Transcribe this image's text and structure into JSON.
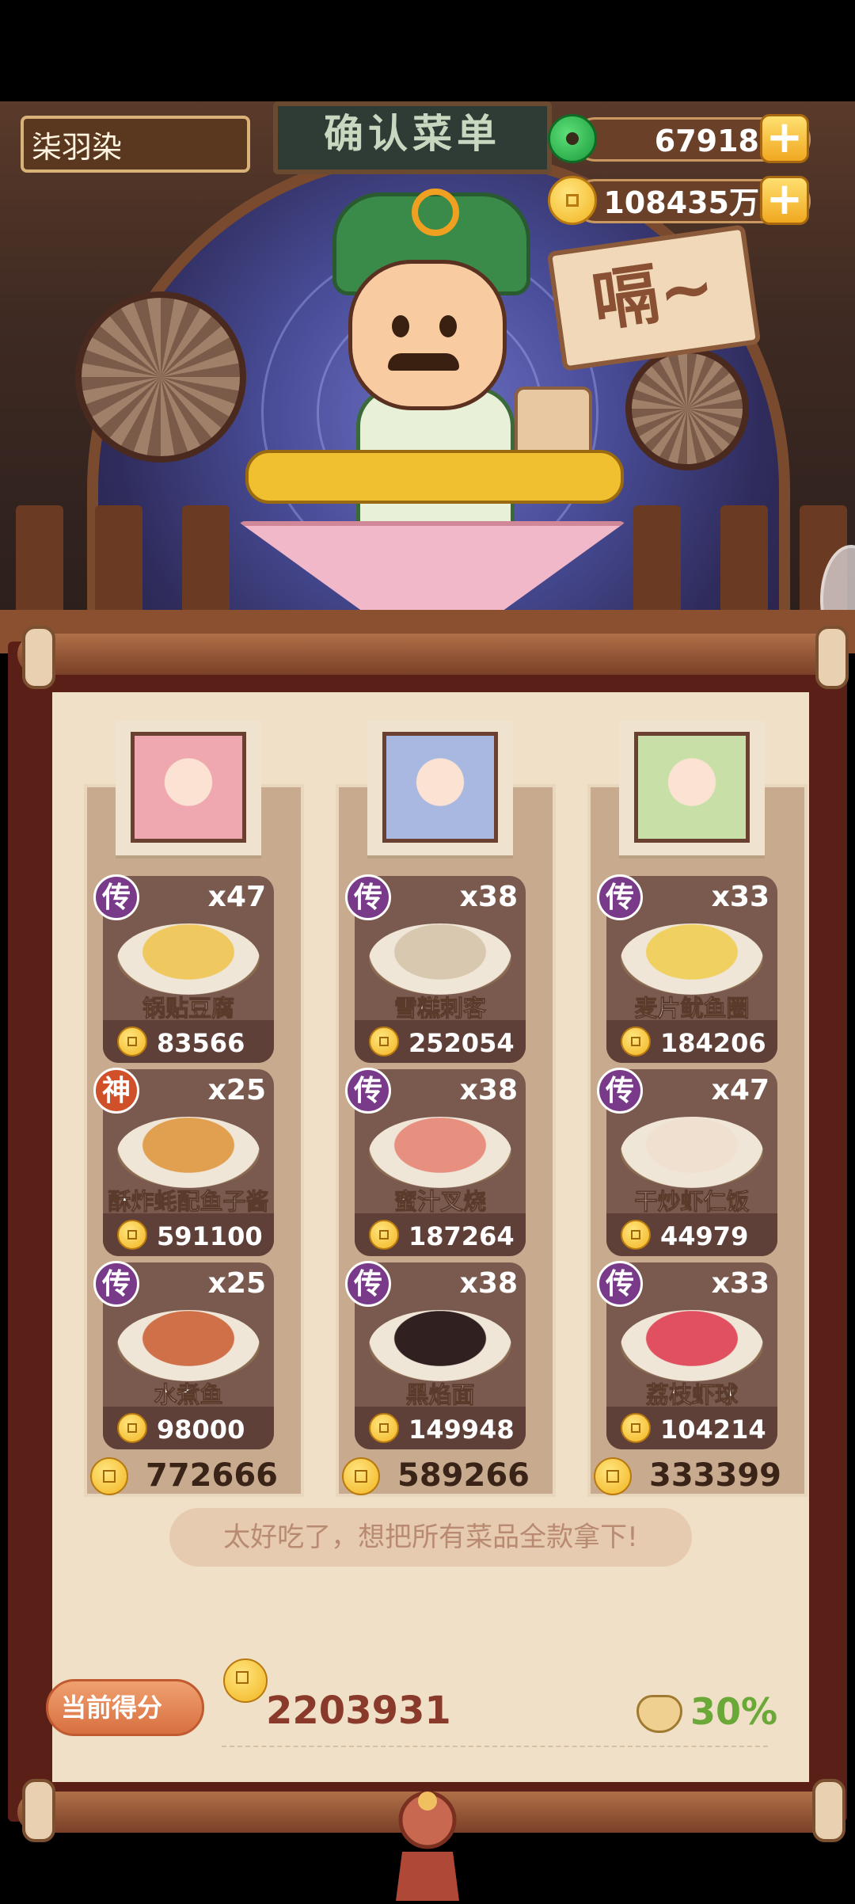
{
  "header": {
    "player_name": "柒羽染",
    "sign_text": "确认菜单",
    "jade_amount": "67918",
    "coin_amount": "108435万",
    "plus_label": "+",
    "speech_text": "嗝~"
  },
  "columns": [
    {
      "total": "772666",
      "dishes": [
        {
          "tier": "传",
          "qty": "x47",
          "name": "锅贴豆腐",
          "price": "83566"
        },
        {
          "tier": "神",
          "qty": "x25",
          "name": "酥炸蚝配鱼子酱",
          "price": "591100"
        },
        {
          "tier": "传",
          "qty": "x25",
          "name": "水煮鱼",
          "price": "98000"
        }
      ]
    },
    {
      "total": "589266",
      "dishes": [
        {
          "tier": "传",
          "qty": "x38",
          "name": "雪糕刺客",
          "price": "252054"
        },
        {
          "tier": "传",
          "qty": "x38",
          "name": "蜜汁叉烧",
          "price": "187264"
        },
        {
          "tier": "传",
          "qty": "x38",
          "name": "黑焰面",
          "price": "149948"
        }
      ]
    },
    {
      "total": "333399",
      "dishes": [
        {
          "tier": "传",
          "qty": "x33",
          "name": "麦片鱿鱼圈",
          "price": "184206"
        },
        {
          "tier": "传",
          "qty": "x47",
          "name": "干炒虾仁饭",
          "price": "44979"
        },
        {
          "tier": "传",
          "qty": "x33",
          "name": "荔枝虾球",
          "price": "104214"
        }
      ]
    }
  ],
  "comment": "太好吃了，想把所有菜品全款拿下!",
  "score": {
    "label": "当前得分",
    "value": "2203931",
    "percent": "30%"
  },
  "colors": {
    "tier_chuan": "#7a3a8a",
    "tier_shen": "#d0502a",
    "percent_green": "#6aa838"
  }
}
